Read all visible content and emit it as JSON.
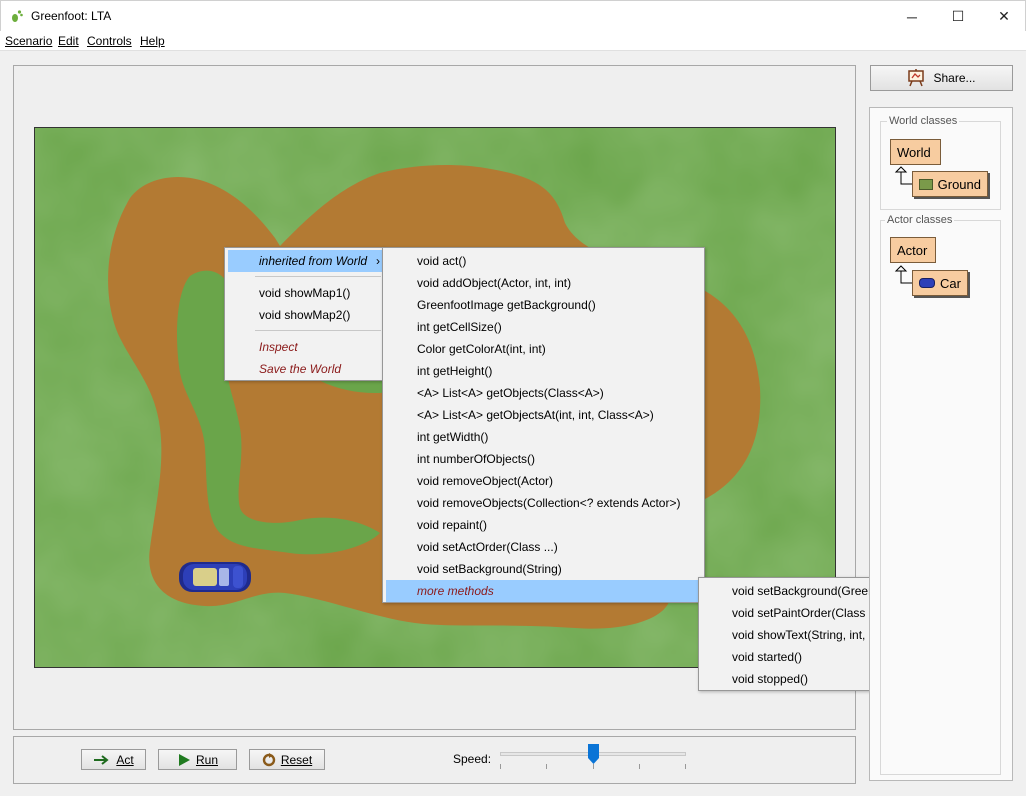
{
  "window": {
    "title": "Greenfoot: LTA",
    "minimize": "─",
    "maximize": "☐",
    "close": "✕"
  },
  "menubar": {
    "scenario": "Scenario",
    "edit": "Edit",
    "controls": "Controls",
    "help": "Help"
  },
  "controls": {
    "act": "Act",
    "run": "Run",
    "reset": "Reset",
    "speed_label": "Speed:",
    "speed_level": 0.5
  },
  "share": {
    "label": "Share..."
  },
  "classes": {
    "world_title": "World classes",
    "world": "World",
    "ground": "Ground",
    "actor_title": "Actor classes",
    "actor": "Actor",
    "car": "Car"
  },
  "context_menu": {
    "inherited": "inherited from World",
    "items": [
      "void showMap1()",
      "void showMap2()"
    ],
    "inspect": "Inspect",
    "save_world": "Save the World"
  },
  "inherited_menu": {
    "items": [
      "void act()",
      "void addObject(Actor, int, int)",
      "GreenfootImage getBackground()",
      "int getCellSize()",
      "Color getColorAt(int, int)",
      "int getHeight()",
      "<A> List<A> getObjects(Class<A>)",
      "<A> List<A> getObjectsAt(int, int, Class<A>)",
      "int getWidth()",
      "int numberOfObjects()",
      "void removeObject(Actor)",
      "void removeObjects(Collection<? extends Actor>)",
      "void repaint()",
      "void setActOrder(Class ...)",
      "void setBackground(String)"
    ],
    "more": "more methods"
  },
  "more_menu": {
    "items": [
      "void setBackground(GreenfootImage)",
      "void setPaintOrder(Class ...)",
      "void showText(String, int, int)",
      "void started()",
      "void stopped()"
    ]
  },
  "colors": {
    "grass": "#6aa54a",
    "dirt": "#b37a33",
    "class_box": "#f7cca0",
    "menu_highlight": "#99ccff"
  }
}
